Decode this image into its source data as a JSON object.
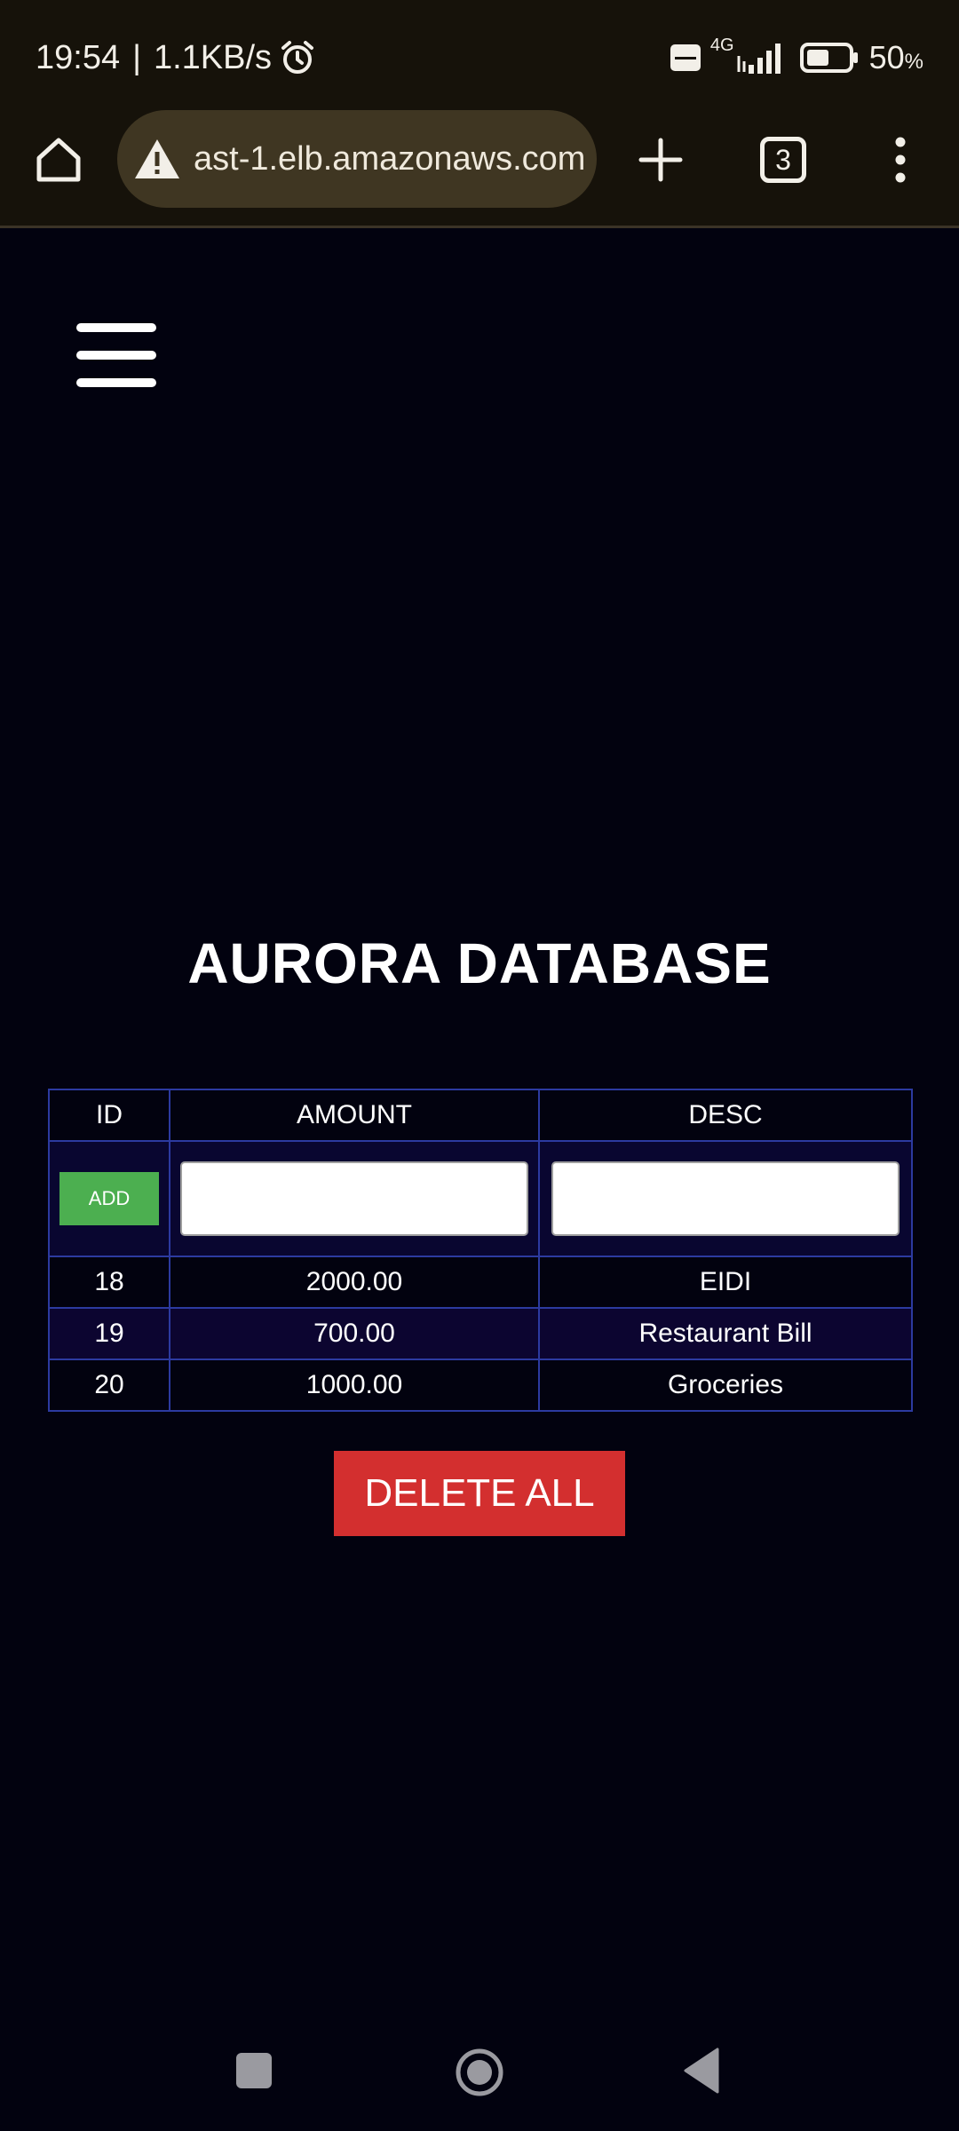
{
  "status_bar": {
    "time": "19:54",
    "separator": "|",
    "net_speed": "1.1KB/s",
    "network_type": "4G",
    "battery_value": "50",
    "battery_unit": "%"
  },
  "browser": {
    "url": "ast-1.elb.amazonaws.com",
    "tab_count": "3"
  },
  "page": {
    "title": "AURORA DATABASE",
    "table": {
      "headers": [
        "ID",
        "AMOUNT",
        "DESC"
      ],
      "add_label": "ADD",
      "amount_input_value": "",
      "desc_input_value": "",
      "rows": [
        {
          "id": "18",
          "amount": "2000.00",
          "desc": "EIDI"
        },
        {
          "id": "19",
          "amount": "700.00",
          "desc": "Restaurant Bill"
        },
        {
          "id": "20",
          "amount": "1000.00",
          "desc": "Groceries"
        }
      ]
    },
    "delete_all_label": "DELETE ALL"
  },
  "colors": {
    "page_background": "#02020f",
    "table_border": "#2c3aa0",
    "add_button": "#4caf50",
    "delete_button": "#d32f2f",
    "browser_bar": "#16120a"
  },
  "icons": {
    "alarm": "alarm-clock-icon",
    "home": "home-icon",
    "warning": "warning-triangle-icon",
    "new_tab": "plus-icon",
    "menu": "three-dots-icon",
    "hamburger": "hamburger-menu-icon"
  }
}
